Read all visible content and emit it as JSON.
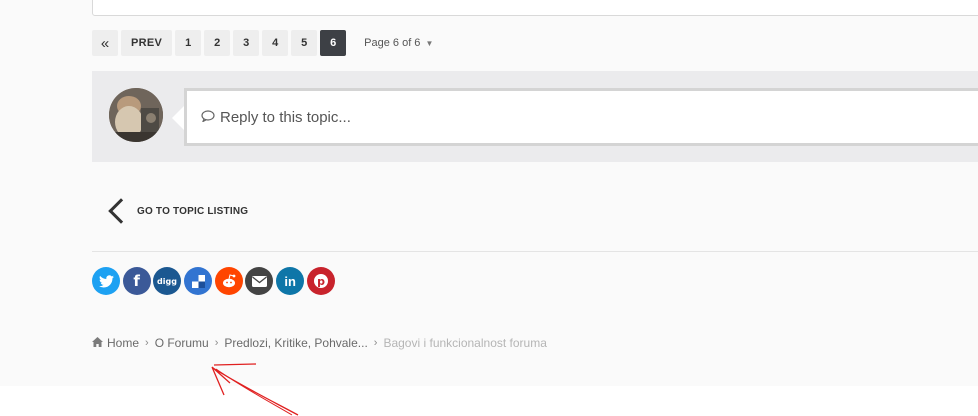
{
  "pagination": {
    "first_label": "«",
    "prev_label": "PREV",
    "pages": [
      "1",
      "2",
      "3",
      "4",
      "5",
      "6"
    ],
    "active_page": "6",
    "page_jump_label": "Page 6 of 6"
  },
  "reply": {
    "placeholder": "Reply to this topic..."
  },
  "topic_listing": {
    "label": "GO TO TOPIC LISTING"
  },
  "share": {
    "items": [
      {
        "name": "twitter-share-button",
        "icon": "twitter-icon",
        "color": "#1da1f2",
        "glyph": "t"
      },
      {
        "name": "facebook-share-button",
        "icon": "facebook-icon",
        "color": "#3b5998",
        "glyph": "f"
      },
      {
        "name": "digg-share-button",
        "icon": "digg-icon",
        "color": "#1b5891",
        "glyph": "digg"
      },
      {
        "name": "delicious-share-button",
        "icon": "delicious-icon",
        "color": "#3274d1",
        "glyph": ""
      },
      {
        "name": "reddit-share-button",
        "icon": "reddit-icon",
        "color": "#ff4500",
        "glyph": ""
      },
      {
        "name": "email-share-button",
        "icon": "envelope-icon",
        "color": "#444444",
        "glyph": ""
      },
      {
        "name": "linkedin-share-button",
        "icon": "linkedin-icon",
        "color": "#0e76a8",
        "glyph": "in"
      },
      {
        "name": "pinterest-share-button",
        "icon": "pinterest-icon",
        "color": "#c8232c",
        "glyph": "p"
      }
    ]
  },
  "breadcrumb": {
    "items": [
      "Home",
      "O Forumu",
      "Predlozi, Kritike, Pohvale..."
    ],
    "current": "Bagovi i funkcionalnost foruma"
  },
  "colors": {
    "active_page": "#3d4045",
    "annotation": "#e02020"
  }
}
